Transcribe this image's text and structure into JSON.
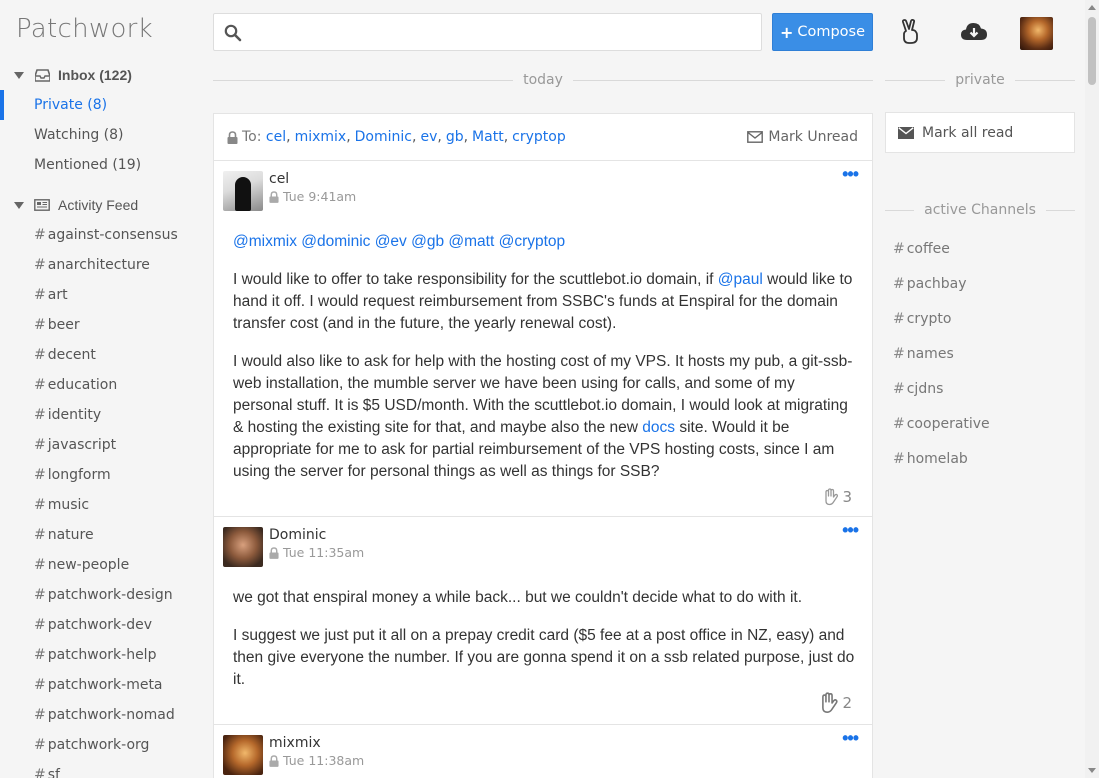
{
  "app": {
    "brand": "Patchwork"
  },
  "sidebar": {
    "inbox": {
      "label": "Inbox (122)",
      "icon": "inbox-icon"
    },
    "inbox_items": [
      {
        "label": "Private (8)",
        "active": true
      },
      {
        "label": "Watching (8)",
        "active": false
      },
      {
        "label": "Mentioned (19)",
        "active": false
      }
    ],
    "activity": {
      "label": "Activity Feed",
      "icon": "newspaper-icon"
    },
    "channels": [
      "against-consensus",
      "anarchitecture",
      "art",
      "beer",
      "decent",
      "education",
      "identity",
      "javascript",
      "longform",
      "music",
      "nature",
      "new-people",
      "patchwork-design",
      "patchwork-dev",
      "patchwork-help",
      "patchwork-meta",
      "patchwork-nomad",
      "patchwork-org",
      "sf"
    ]
  },
  "topbar": {
    "search": {
      "placeholder": "",
      "value": "",
      "icon": "search-icon"
    },
    "compose_label": "Compose",
    "icons": [
      "peace-hand-icon",
      "cloud-download-icon",
      "user-avatar"
    ]
  },
  "dividers": {
    "today": "today",
    "private": "private",
    "active_channels": "active Channels"
  },
  "thread": {
    "to_label": "To:",
    "recipients": [
      "cel",
      "mixmix",
      "Dominic",
      "ev",
      "gb",
      "Matt",
      "cryptop"
    ],
    "mark_unread": "Mark Unread"
  },
  "messages": [
    {
      "author": "cel",
      "time": "Tue 9:41am",
      "mentions": "@mixmix @dominic @ev @gb @matt @cryptop",
      "p1_before": "I would like to offer to take responsibility for the scuttlebot.io domain, if ",
      "p1_link": "@paul",
      "p1_after": " would like to hand it off. I would request reimbursement from SSBC's funds at Enspiral for the domain transfer cost (and in the future, the yearly renewal cost).",
      "p2_before": "I would also like to ask for help with the hosting cost of my VPS. It hosts my pub, a git-ssb-web installation, the mumble server we have been using for calls, and some of my personal stuff. It is $5 USD/month. With the scuttlebot.io domain, I would look at migrating & hosting the existing site for that, and maybe also the new ",
      "p2_link": "docs",
      "p2_after": " site. Would it be appropriate for me to ask for partial reimbursement of the VPS hosting costs, since I am using the server for personal things as well as things for SSB?",
      "likes": "3"
    },
    {
      "author": "Dominic",
      "time": "Tue 11:35am",
      "p1": "we got that enspiral money a while back... but we couldn't decide what to do with it.",
      "p2": "I suggest we just put it all on a prepay credit card ($5 fee at a post office in NZ, easy) and then give everyone the number. If you are gonna spend it on a ssb related purpose, just do it.",
      "likes": "2"
    },
    {
      "author": "mixmix",
      "time": "Tue 11:38am"
    }
  ],
  "right": {
    "mark_all_read": "Mark all read",
    "channels": [
      "coffee",
      "pachbay",
      "crypto",
      "names",
      "cjdns",
      "cooperative",
      "homelab"
    ]
  },
  "colors": {
    "accent": "#1a73e8",
    "compose_bg": "#3a8ee6"
  }
}
